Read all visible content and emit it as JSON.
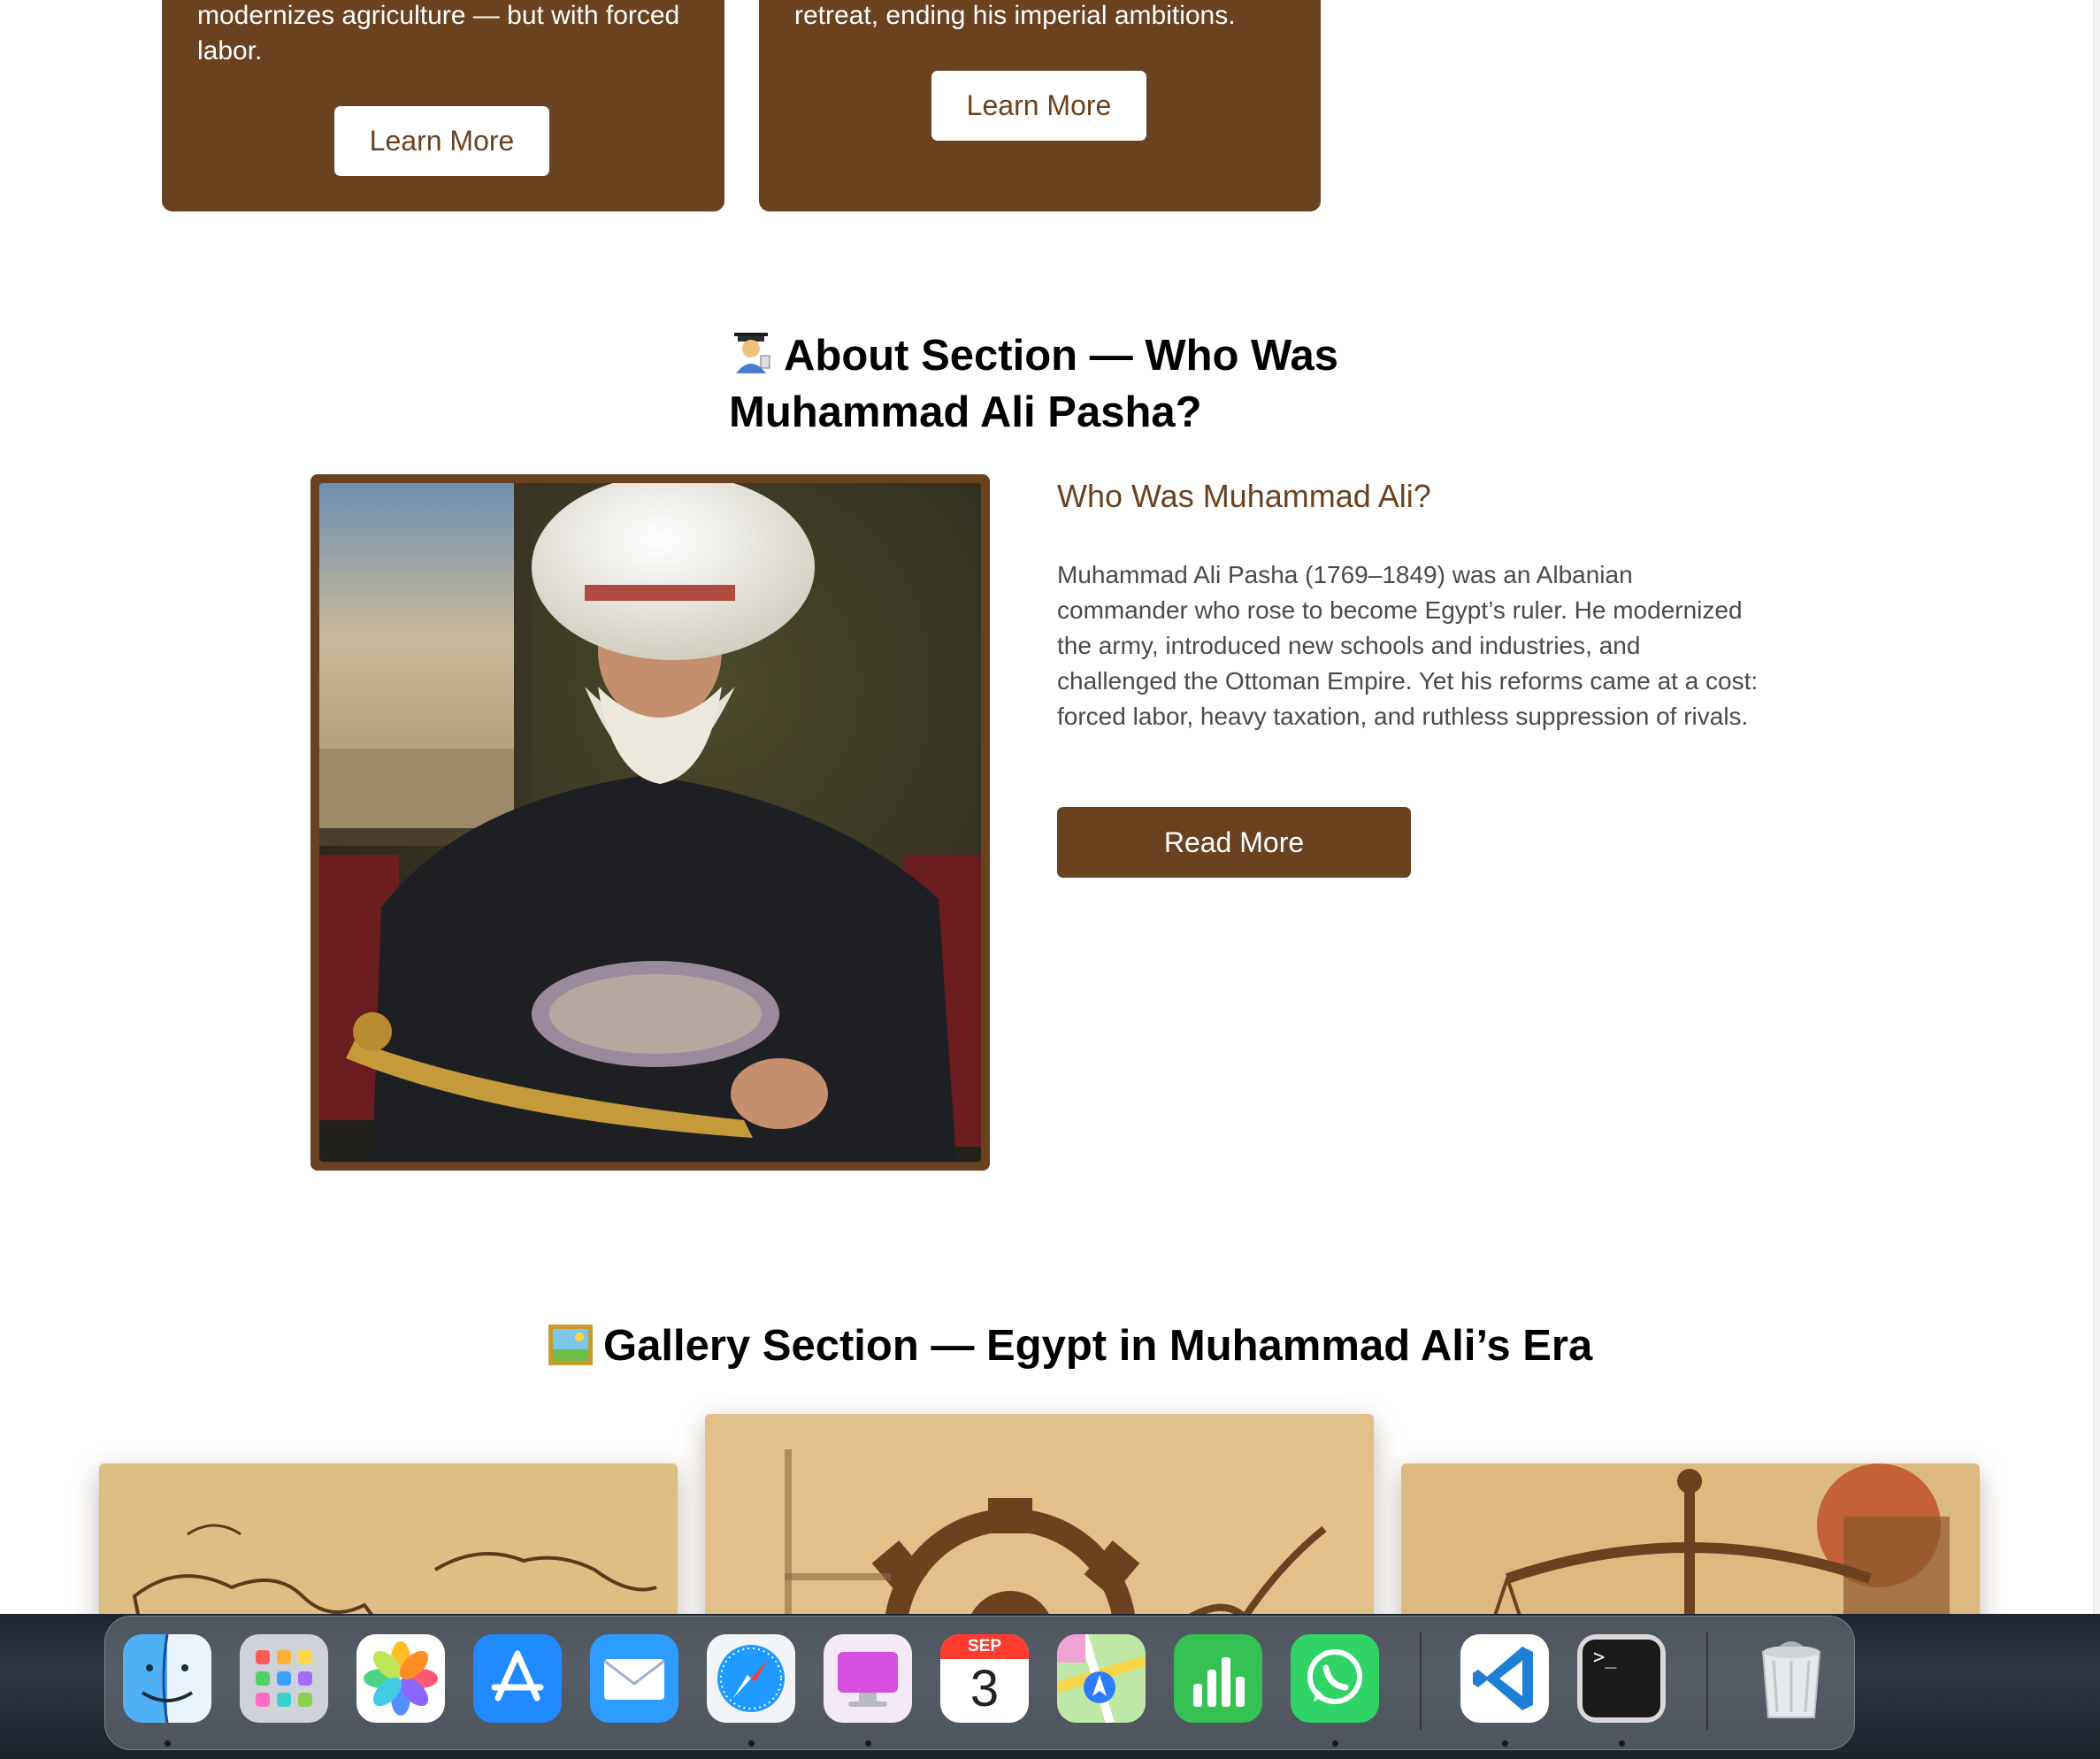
{
  "cards": [
    {
      "text": "modernizes agriculture — but with forced labor.",
      "button": "Learn More"
    },
    {
      "text": "retreat, ending his imperial ambitions.",
      "button": "Learn More"
    }
  ],
  "about": {
    "title": "About Section — Who Was Muhammad Ali Pasha?",
    "subtitle": "Who Was Muhammad Ali?",
    "body": "Muhammad Ali Pasha (1769–1849) was an Albanian commander who rose to become Egypt’s ruler. He modernized the army, introduced new schools and industries, and challenged the Ottoman Empire. Yet his reforms came at a cost: forced labor, heavy taxation, and ruthless suppression of rivals.",
    "button": "Read More"
  },
  "gallery": {
    "title": "Gallery Section — Egypt in Muhammad Ali’s Era"
  },
  "dock": {
    "calendar_month": "SEP",
    "calendar_day": "3",
    "terminal_prompt": ">_"
  },
  "colors": {
    "brand_brown": "#6b4220",
    "body_text": "#4a4a4a"
  }
}
